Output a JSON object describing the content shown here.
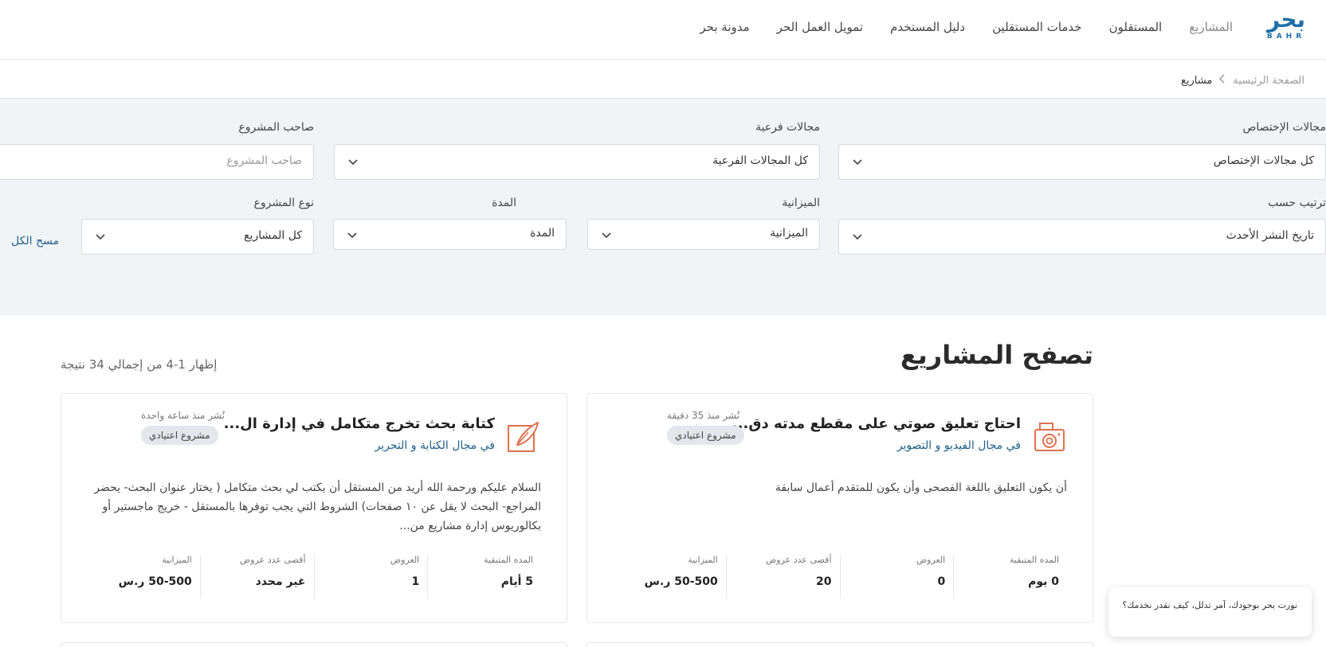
{
  "header": {
    "logo_ar": "بحر",
    "logo_en": "BAHR",
    "nav": [
      {
        "label": "المشاريع"
      },
      {
        "label": "المستقلون"
      },
      {
        "label": "خدمات المستقلين"
      },
      {
        "label": "دليل المستخدم"
      },
      {
        "label": "تمويل العمل الحر"
      },
      {
        "label": "مدونة بحر"
      }
    ]
  },
  "breadcrumb": {
    "home": "الصفحة الرئيسية",
    "current": "مشاريع"
  },
  "filters": {
    "specialization": {
      "label": "مجالات الإختصاص",
      "value": "كل مجالات الإختصاص"
    },
    "subfields": {
      "label": "مجالات فرعية",
      "value": "كل المجالات الفرعية"
    },
    "owner": {
      "label": "صاحب المشروع",
      "placeholder": "صاحب المشروع"
    },
    "sort": {
      "label": "ترتيب حسب",
      "value": "تاريخ النشر الأحدث"
    },
    "budget": {
      "label": "الميزانية",
      "value": "الميزانية"
    },
    "duration": {
      "label": "المدة",
      "value": "المدة"
    },
    "project_type": {
      "label": "نوع المشروع",
      "value": "كل المشاريع"
    },
    "clear_all": "مسح الكل"
  },
  "main": {
    "title": "تصفح المشاريع",
    "result_count": "إظهار 1-4 من إجمالي 34 نتيجة"
  },
  "projects": [
    {
      "icon": "camera-icon",
      "title": "احتاج تعليق صوتي على مقطع مدته دق...",
      "category": "في مجال الفيديو و التصوير",
      "posted": "نُشر منذ 35 دقيقة",
      "badge": "مشروع اعتيادي",
      "description": "أن يكون التعليق باللغة الفصحى وأن يكون للمتقدم أعمال سابقة",
      "stats": [
        {
          "label": "المده المتبقية",
          "value": "0 يوم"
        },
        {
          "label": "العروض",
          "value": "0"
        },
        {
          "label": "أقصى عدد عروض",
          "value": "20"
        },
        {
          "label": "الميزانية",
          "value": "50-500 ر.س"
        }
      ]
    },
    {
      "icon": "quill-pen-icon",
      "title": "كتابة بحث تخرج متكامل في إدارة ال...",
      "category": "في مجال الكتابة و التحرير",
      "posted": "نُشر منذ ساعة واحدة",
      "badge": "مشروع اعتيادي",
      "description": "السلام عليكم ورحمة الله أريد من المستقل أن يكتب لي بحث متكامل ( يختار عنوان البحث- يحضر المراجع- البحث لا يقل عن ١٠ صفحات) الشروط التي يجب توفرها بالمستقل - خريج ماجستير أو بكالوريوس إدارة مشاريع من...",
      "stats": [
        {
          "label": "المده المتبقية",
          "value": "5 أيام"
        },
        {
          "label": "العروض",
          "value": "1"
        },
        {
          "label": "أقصى عدد عروض",
          "value": "غير محدد"
        },
        {
          "label": "الميزانية",
          "value": "50-500 ر.س"
        }
      ]
    }
  ],
  "chat": {
    "message": "نورت بحر بوجودك، آمر تدلل، كيف نقدر نخدمك؟"
  },
  "colors": {
    "brand": "#1f6fa8",
    "link": "#1f5f8b",
    "icon_accent": "#e0704f",
    "filter_bg": "#f1f4f7"
  }
}
